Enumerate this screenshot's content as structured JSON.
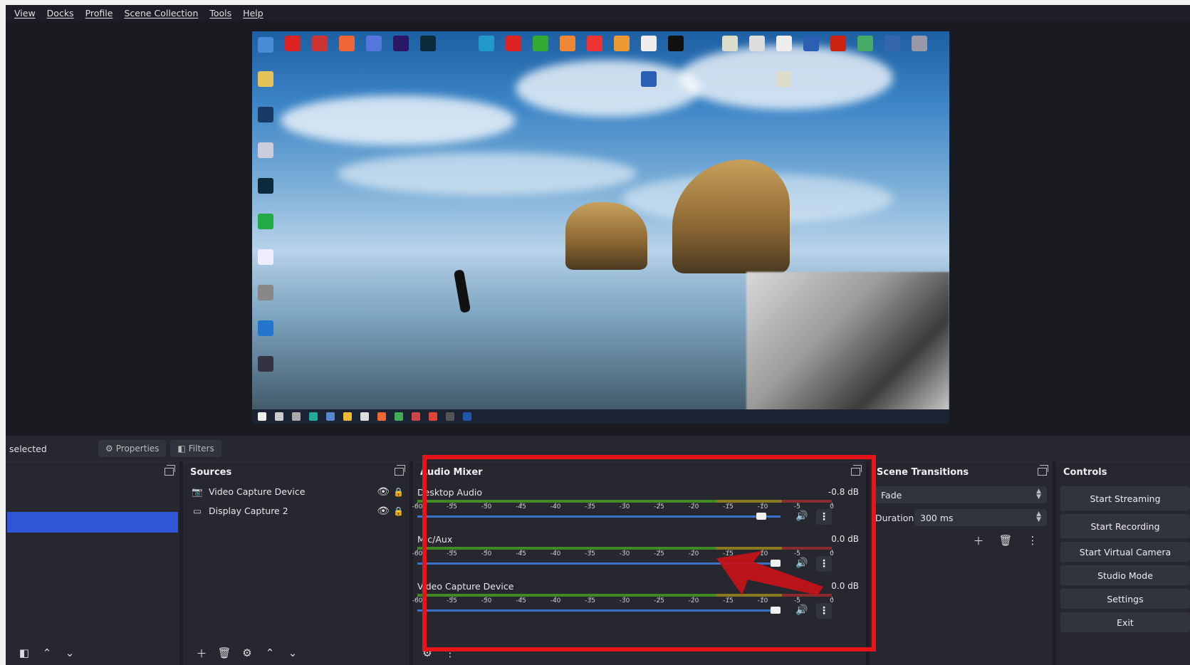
{
  "menu": [
    "View",
    "Docks",
    "Profile",
    "Scene Collection",
    "Tools",
    "Help"
  ],
  "context_bar": {
    "label": "selected",
    "properties": "Properties",
    "filters": "Filters"
  },
  "sources": {
    "title": "Sources",
    "items": [
      {
        "name": "Video Capture Device",
        "icon": "camera-icon"
      },
      {
        "name": "Display Capture 2",
        "icon": "monitor-icon"
      }
    ]
  },
  "mixer": {
    "title": "Audio Mixer",
    "ticks": [
      "-60",
      "-55",
      "-50",
      "-45",
      "-40",
      "-35",
      "-30",
      "-25",
      "-20",
      "-15",
      "-10",
      "-5",
      "0"
    ],
    "channels": [
      {
        "name": "Desktop Audio",
        "db": "-0.8 dB",
        "volume": 0.96
      },
      {
        "name": "Mic/Aux",
        "db": "0.0 dB",
        "volume": 1.0
      },
      {
        "name": "Video Capture Device",
        "db": "0.0 dB",
        "volume": 1.0
      }
    ]
  },
  "transitions": {
    "title": "Scene Transitions",
    "selected": "Fade",
    "duration_label": "Duration",
    "duration": "300 ms"
  },
  "controls": {
    "title": "Controls",
    "buttons": [
      "Start Streaming",
      "Start Recording",
      "Start Virtual Camera",
      "Studio Mode",
      "Settings",
      "Exit"
    ]
  },
  "colors": {
    "annotation": "#e8141c",
    "accent": "#2f56d6",
    "slider": "#3b72c9"
  }
}
